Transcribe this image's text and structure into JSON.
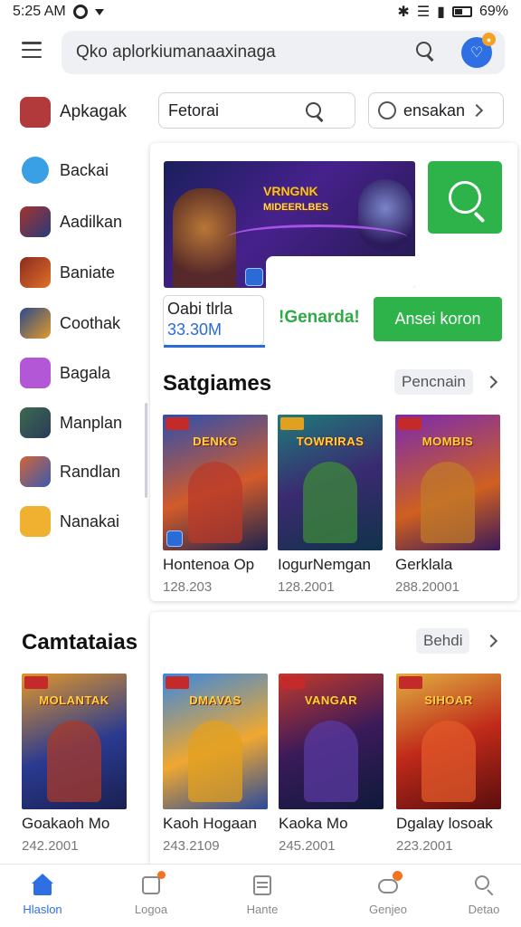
{
  "status_bar": {
    "time": "5:25 AM",
    "battery": "69%"
  },
  "search": {
    "text": "Qko aplorkiumanaaxinaga"
  },
  "sidebar": {
    "items": [
      {
        "label": "Apkagak",
        "color": "#b23a3a"
      },
      {
        "label": "Backai",
        "color": "#3aa0e6"
      },
      {
        "label": "Aadilkan",
        "color": "#a3342e"
      },
      {
        "label": "Baniate",
        "color": "#8a2a1e"
      },
      {
        "label": "Coothak",
        "color": "#2c4a8a"
      },
      {
        "label": "Bagala",
        "color": "#b457d6"
      },
      {
        "label": "Manplan",
        "color": "#3d6a4e"
      },
      {
        "label": "Randlan",
        "color": "#d0663a"
      },
      {
        "label": "Nanakai",
        "color": "#f0b030"
      }
    ]
  },
  "filters": {
    "primary": "Fetorai",
    "secondary": "ensakan"
  },
  "featured": {
    "banner_title": "VRNGNK",
    "banner_subtitle": "MIDEERLBES",
    "stat_label": "Oabi tlrla",
    "stat_value": "33.30M",
    "green_text": "!Genarda!",
    "install_label": "Ansei koron"
  },
  "section1": {
    "title": "Satgiames",
    "pill": "Pencnain",
    "games": [
      {
        "name": "Hontenoa Op",
        "count": "128.203",
        "logo": "DENKG",
        "bg": "linear-gradient(160deg,#2a4fb0 0%,#d35b2a 55%,#1c244e 100%)",
        "fig": "#b83a2a"
      },
      {
        "name": "IogurNemgan",
        "count": "128.2001",
        "logo": "TOWRIRAS",
        "bg": "linear-gradient(160deg,#1f7a7a 0%,#3a2a70 50%,#10334a 100%)",
        "fig": "#3e8a3a"
      },
      {
        "name": "Gerklala",
        "count": "288.20001",
        "logo": "MOMBIS",
        "bg": "linear-gradient(160deg,#7a2ab0 0%,#d06020 60%,#3a1a5a 100%)",
        "fig": "#c07a2a"
      }
    ]
  },
  "section2": {
    "title": "Camtataias",
    "pill": "Behdi",
    "games": [
      {
        "name": "Goakaoh Mo",
        "count": "242.2001",
        "logo": "MOLANTAK",
        "bg": "linear-gradient(160deg,#e0962a 0%,#2a3a90 55%,#1a2050 100%)",
        "fig": "#a83a2a"
      },
      {
        "name": "Kaoh Hogaan",
        "count": "243.2109",
        "logo": "DMAVAS",
        "bg": "linear-gradient(160deg,#3a88e0 0%,#f0a830 55%,#2a4a9a 100%)",
        "fig": "#e2a020"
      },
      {
        "name": "Kaoka Mo",
        "count": "245.2001",
        "logo": "VANGAR",
        "bg": "linear-gradient(160deg,#c23a2a 0%,#3a1a5a 50%,#0e1a3a 100%)",
        "fig": "#5a3aa0"
      },
      {
        "name": "Dgalay losoak",
        "count": "223.2001",
        "logo": "SIHOAR",
        "bg": "linear-gradient(160deg,#e0b040 0%,#c02a1a 50%,#5a0e0e 100%)",
        "fig": "#e25a2a"
      }
    ]
  },
  "bottom_nav": [
    {
      "label": "Hlaslon",
      "icon": "home-icon",
      "active": true
    },
    {
      "label": "Logoa",
      "icon": "apps-icon",
      "active": false
    },
    {
      "label": "Hante",
      "icon": "list-icon",
      "active": false
    },
    {
      "label": "Genjeo",
      "icon": "games-icon",
      "active": false
    },
    {
      "label": "Detao",
      "icon": "search-icon",
      "active": false
    }
  ],
  "colors": {
    "accent_blue": "#2f6fe4",
    "accent_green": "#2eb34a",
    "badge_orange": "#f3a224"
  }
}
